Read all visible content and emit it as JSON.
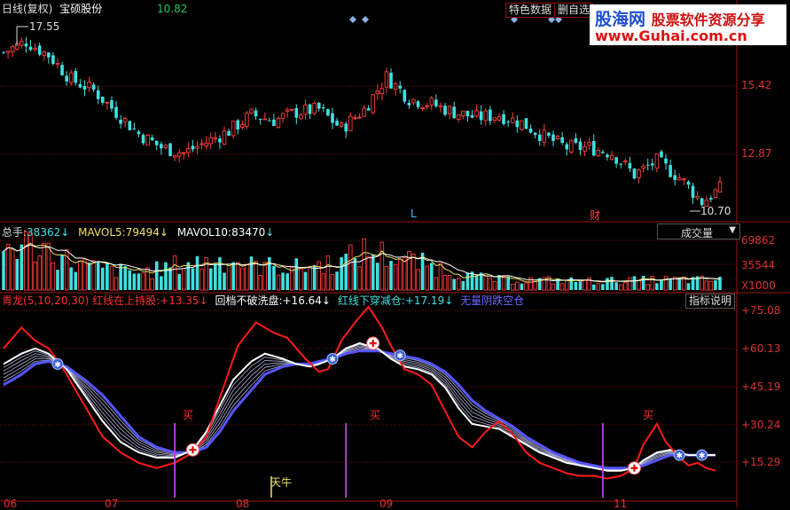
{
  "header": {
    "period": "日线(复权)",
    "stock_name": "宝硕股份",
    "price": "10.82",
    "price_color": "#22c55e",
    "buttons": [
      "特色数据",
      "删自选"
    ]
  },
  "watermark": {
    "site_cn": "股海网",
    "slogan": "股票软件资源分享",
    "url": "www.Guhai.com.cn"
  },
  "price_panel": {
    "y_ticks": [
      "15.42",
      "12.87"
    ],
    "high_label": "17.55",
    "low_label": "10.70",
    "marker_l": "L",
    "marker_cai": "财"
  },
  "volume_panel": {
    "label_total": "总手:",
    "total": "38362",
    "label_mavol5": "MAVOL5:",
    "mavol5": "79494",
    "label_mavol10": "MAVOL10:",
    "mavol10": "83470",
    "arrow": "↓",
    "selector": "成交量",
    "selector_icon": "chevron-down-icon",
    "y_ticks": [
      "69862",
      "35544",
      "X1000"
    ]
  },
  "indicator_panel": {
    "title": "青龙(5,10,20,30)",
    "item1_label": "红线在上持股:",
    "item1_value": "+13.35",
    "item2_label": "回档不破洗盘:",
    "item2_value": "+16.64",
    "item3_label": "红线下穿减仓:",
    "item3_value": "+17.19",
    "item4_label": "无量阴跌空仓",
    "arrow": "↓",
    "help_button": "指标说明",
    "y_ticks": [
      "+75.08",
      "+60.13",
      "+45.19",
      "+30.24",
      "+15.29"
    ],
    "buy_label": "买",
    "tianniu_label": "天牛"
  },
  "x_axis": {
    "ticks": [
      "06",
      "07",
      "08",
      "09",
      "11"
    ]
  },
  "chart_data": {
    "type": "candlestick",
    "bars": 160,
    "price_range": [
      10.7,
      17.55
    ],
    "price_trend": [
      [
        0,
        16.6
      ],
      [
        5,
        17.0
      ],
      [
        10,
        16.5
      ],
      [
        15,
        15.6
      ],
      [
        20,
        15.2
      ],
      [
        25,
        14.4
      ],
      [
        30,
        13.6
      ],
      [
        35,
        13.1
      ],
      [
        40,
        12.9
      ],
      [
        45,
        13.3
      ],
      [
        50,
        13.7
      ],
      [
        55,
        14.3
      ],
      [
        60,
        14.1
      ],
      [
        65,
        14.4
      ],
      [
        70,
        14.5
      ],
      [
        75,
        13.8
      ],
      [
        80,
        14.5
      ],
      [
        85,
        15.7
      ],
      [
        90,
        14.9
      ],
      [
        95,
        14.7
      ],
      [
        100,
        14.4
      ],
      [
        105,
        14.2
      ],
      [
        110,
        14.3
      ],
      [
        115,
        14.0
      ],
      [
        120,
        13.5
      ],
      [
        125,
        13.1
      ],
      [
        130,
        13.1
      ],
      [
        135,
        12.9
      ],
      [
        140,
        12.1
      ],
      [
        145,
        12.6
      ],
      [
        150,
        12.0
      ],
      [
        155,
        11.1
      ],
      [
        160,
        11.7
      ]
    ],
    "volume_trend": [
      [
        0,
        60
      ],
      [
        5,
        66
      ],
      [
        10,
        58
      ],
      [
        15,
        40
      ],
      [
        20,
        32
      ],
      [
        30,
        24
      ],
      [
        35,
        30
      ],
      [
        40,
        38
      ],
      [
        45,
        40
      ],
      [
        50,
        44
      ],
      [
        55,
        35
      ],
      [
        60,
        34
      ],
      [
        65,
        32
      ],
      [
        70,
        36
      ],
      [
        75,
        40
      ],
      [
        80,
        55
      ],
      [
        85,
        50
      ],
      [
        90,
        42
      ],
      [
        95,
        34
      ],
      [
        100,
        26
      ],
      [
        105,
        18
      ],
      [
        110,
        15
      ],
      [
        120,
        14
      ],
      [
        130,
        13
      ],
      [
        140,
        14
      ],
      [
        150,
        15
      ],
      [
        158,
        14
      ]
    ],
    "indicator_red": [
      [
        0,
        62
      ],
      [
        4,
        70
      ],
      [
        7,
        65
      ],
      [
        10,
        62
      ],
      [
        13,
        55
      ],
      [
        17,
        43
      ],
      [
        22,
        28
      ],
      [
        26,
        22
      ],
      [
        30,
        18
      ],
      [
        34,
        16
      ],
      [
        38,
        18
      ],
      [
        42,
        22
      ],
      [
        45,
        28
      ],
      [
        49,
        48
      ],
      [
        52,
        63
      ],
      [
        56,
        72
      ],
      [
        60,
        68
      ],
      [
        63,
        66
      ],
      [
        67,
        58
      ],
      [
        70,
        53
      ],
      [
        72,
        54
      ],
      [
        75,
        65
      ],
      [
        78,
        72
      ],
      [
        81,
        78
      ],
      [
        84,
        70
      ],
      [
        86,
        63
      ],
      [
        89,
        54
      ],
      [
        92,
        52
      ],
      [
        95,
        48
      ],
      [
        98,
        38
      ],
      [
        101,
        28
      ],
      [
        104,
        24
      ],
      [
        107,
        30
      ],
      [
        110,
        34
      ],
      [
        113,
        29
      ],
      [
        116,
        22
      ],
      [
        119,
        18
      ],
      [
        122,
        16
      ],
      [
        125,
        14
      ],
      [
        128,
        13
      ],
      [
        131,
        13
      ],
      [
        134,
        12
      ],
      [
        137,
        13
      ],
      [
        140,
        16
      ],
      [
        142,
        25
      ],
      [
        145,
        33
      ],
      [
        147,
        26
      ],
      [
        150,
        20
      ],
      [
        152,
        17
      ],
      [
        154,
        18
      ],
      [
        156,
        16
      ],
      [
        158,
        15
      ]
    ],
    "indicator_white": [
      [
        0,
        56
      ],
      [
        4,
        60
      ],
      [
        7,
        62
      ],
      [
        10,
        60
      ],
      [
        14,
        54
      ],
      [
        18,
        44
      ],
      [
        22,
        34
      ],
      [
        26,
        26
      ],
      [
        30,
        22
      ],
      [
        34,
        20
      ],
      [
        38,
        20
      ],
      [
        42,
        23
      ],
      [
        45,
        30
      ],
      [
        48,
        40
      ],
      [
        51,
        50
      ],
      [
        55,
        57
      ],
      [
        58,
        60
      ],
      [
        62,
        58
      ],
      [
        65,
        56
      ],
      [
        68,
        55
      ],
      [
        70,
        56
      ],
      [
        73,
        58
      ],
      [
        76,
        62
      ],
      [
        79,
        64
      ],
      [
        83,
        62
      ],
      [
        86,
        58
      ],
      [
        89,
        55
      ],
      [
        92,
        54
      ],
      [
        95,
        52
      ],
      [
        98,
        47
      ],
      [
        101,
        39
      ],
      [
        104,
        33
      ],
      [
        107,
        32
      ],
      [
        110,
        31
      ],
      [
        113,
        28
      ],
      [
        116,
        25
      ],
      [
        119,
        22
      ],
      [
        122,
        20
      ],
      [
        125,
        18
      ],
      [
        128,
        17
      ],
      [
        131,
        16
      ],
      [
        134,
        15
      ],
      [
        137,
        15
      ],
      [
        140,
        16
      ],
      [
        142,
        19
      ],
      [
        145,
        22
      ],
      [
        148,
        23
      ],
      [
        150,
        22
      ],
      [
        152,
        21
      ],
      [
        154,
        21
      ],
      [
        158,
        21
      ]
    ],
    "indicator_blue": [
      [
        0,
        48
      ],
      [
        4,
        52
      ],
      [
        7,
        56
      ],
      [
        10,
        57
      ],
      [
        14,
        55
      ],
      [
        18,
        50
      ],
      [
        22,
        44
      ],
      [
        26,
        36
      ],
      [
        30,
        28
      ],
      [
        34,
        24
      ],
      [
        38,
        22
      ],
      [
        42,
        22
      ],
      [
        45,
        24
      ],
      [
        48,
        30
      ],
      [
        51,
        38
      ],
      [
        55,
        46
      ],
      [
        58,
        52
      ],
      [
        62,
        55
      ],
      [
        65,
        56
      ],
      [
        68,
        56
      ],
      [
        70,
        57
      ],
      [
        73,
        58
      ],
      [
        76,
        60
      ],
      [
        79,
        61
      ],
      [
        83,
        61
      ],
      [
        86,
        60
      ],
      [
        89,
        59
      ],
      [
        92,
        58
      ],
      [
        95,
        56
      ],
      [
        98,
        53
      ],
      [
        101,
        48
      ],
      [
        104,
        42
      ],
      [
        107,
        38
      ],
      [
        110,
        35
      ],
      [
        113,
        32
      ],
      [
        116,
        28
      ],
      [
        119,
        25
      ],
      [
        122,
        22
      ],
      [
        125,
        20
      ],
      [
        128,
        18
      ],
      [
        131,
        17
      ],
      [
        134,
        16
      ],
      [
        137,
        16
      ],
      [
        140,
        16
      ],
      [
        142,
        17
      ],
      [
        145,
        19
      ],
      [
        148,
        21
      ],
      [
        150,
        21
      ],
      [
        152,
        21
      ],
      [
        154,
        21
      ],
      [
        158,
        21
      ]
    ],
    "indicator_range": [
      5,
      80
    ],
    "buy_signals_x": [
      38,
      76,
      133
    ],
    "colors": {
      "up": "#ff3c3c",
      "down": "#40e0e0",
      "red_line": "#ff1a1a",
      "white_line": "#ffffff",
      "blue_line": "#5555ff",
      "buy_line": "#b040d0",
      "marker": "#6aa6ff"
    }
  }
}
